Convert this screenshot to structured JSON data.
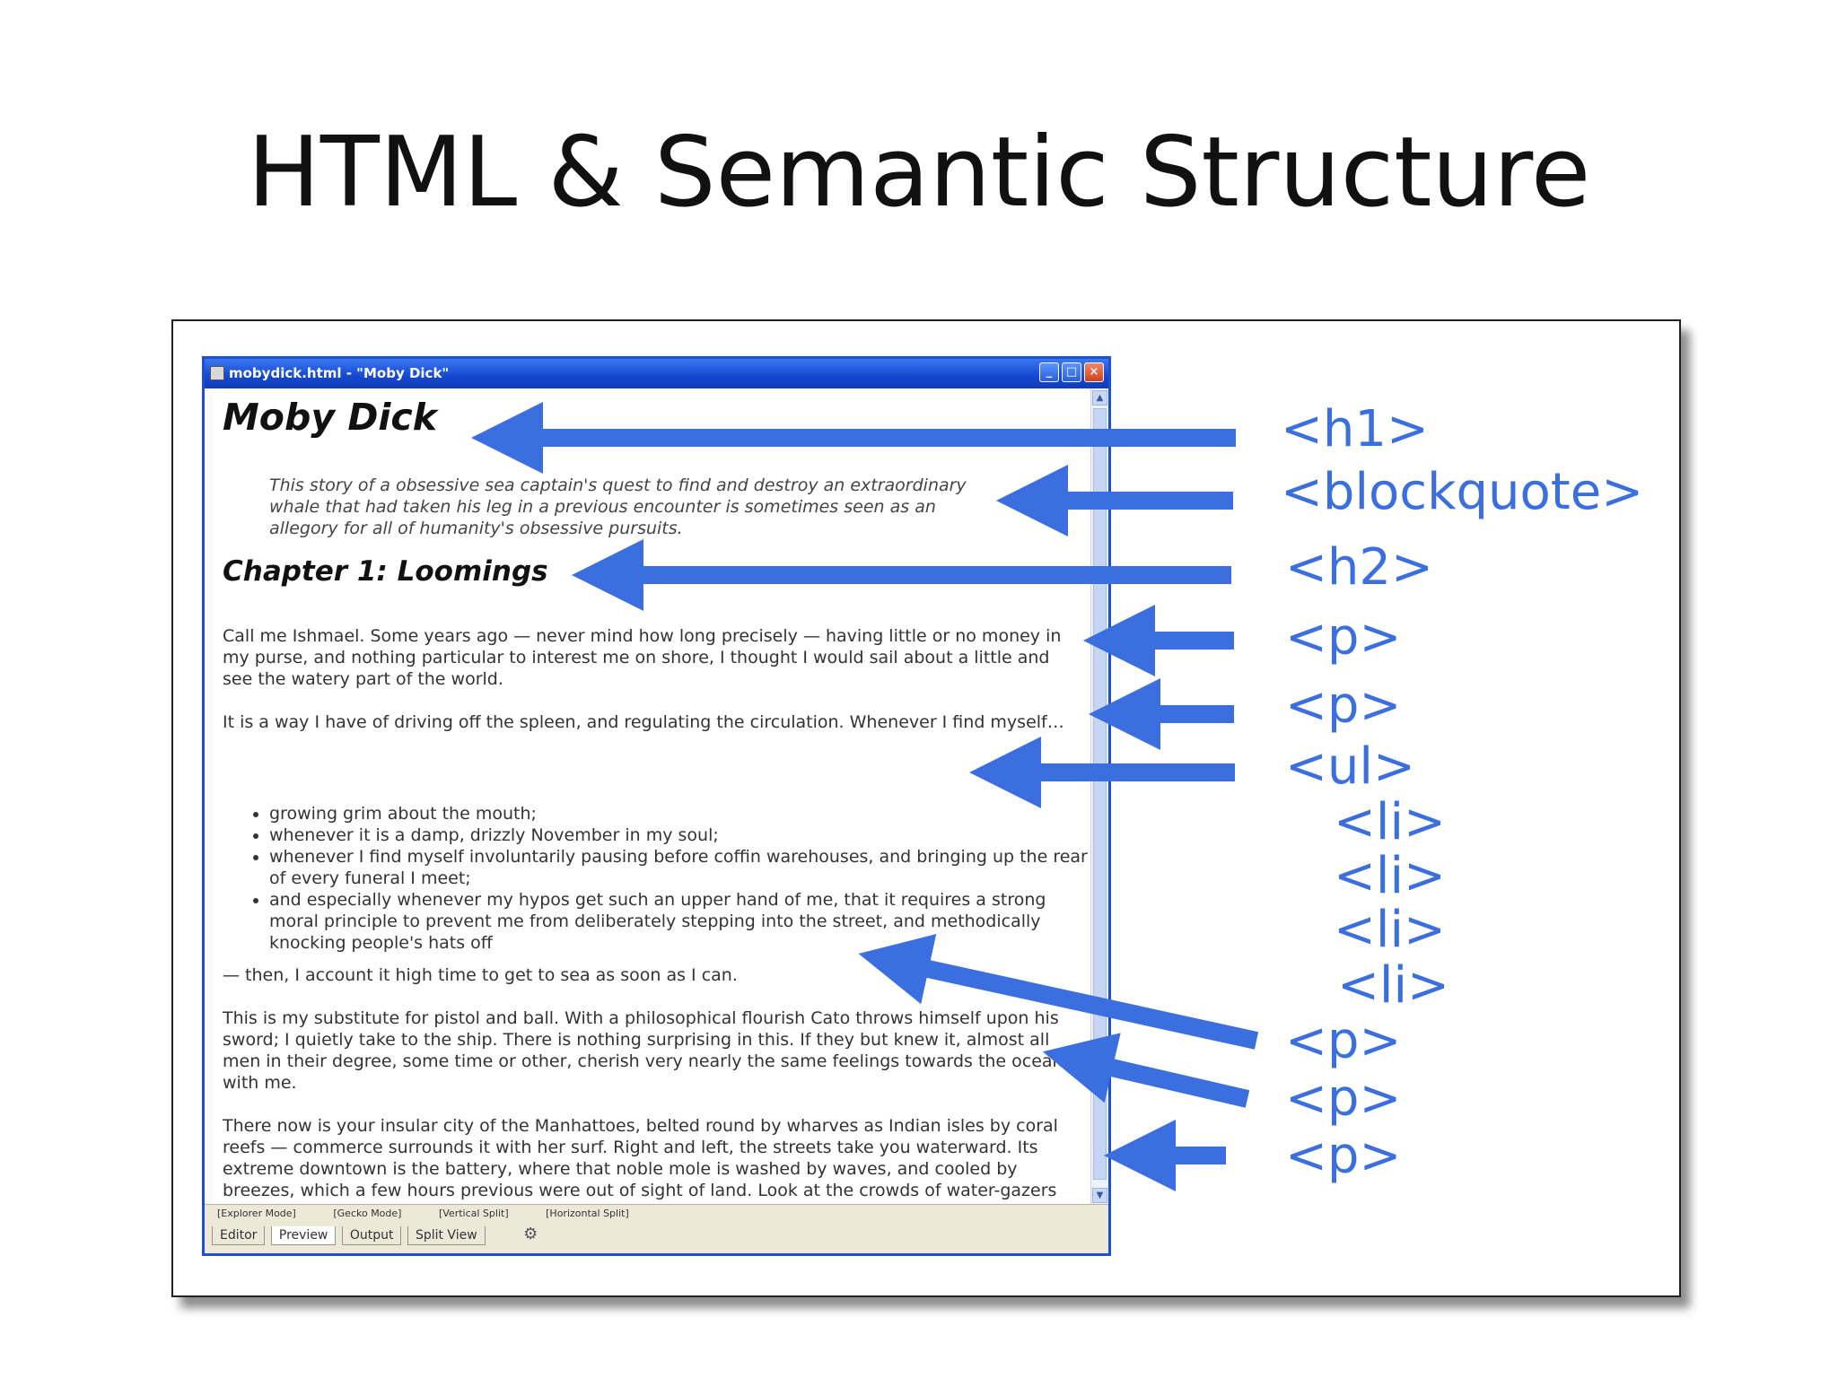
{
  "slide": {
    "title": "HTML & Semantic Structure"
  },
  "window": {
    "title": "mobydick.html - \"Moby Dick\"",
    "controls": {
      "minimize": "_",
      "maximize": "□",
      "close": "×"
    }
  },
  "document": {
    "h1": "Moby Dick",
    "blockquote": "This story of a obsessive sea captain's quest to find and destroy an extraordinary whale that had taken his leg in a previous encounter is sometimes seen as an allegory for all of humanity's obsessive pursuits.",
    "h2": "Chapter 1: Loomings",
    "paragraphs": [
      "Call me Ishmael. Some years ago — never mind how long precisely — having little or no money in my purse, and nothing particular to interest me on shore, I thought I would sail about a little and see the watery part of the world.",
      "It is a way I have of driving off the spleen, and regulating the circulation. Whenever I find myself…",
      "— then, I account it high time to get to sea as soon as I can.",
      "This is my substitute for pistol and ball. With a philosophical flourish Cato throws himself upon his sword; I quietly take to the ship. There is nothing surprising in this. If they but knew it, almost all men in their degree, some time or other, cherish very nearly the same feelings towards the ocean with me.",
      "There now is your insular city of the Manhattoes, belted round by wharves as Indian isles by coral reefs — commerce surrounds it with her surf. Right and left, the streets take you waterward. Its extreme downtown is the battery, where that noble mole is washed by waves, and cooled by breezes, which a few hours previous were out of sight of land. Look at the crowds of water-gazers there."
    ],
    "list": [
      "growing grim about the mouth;",
      "whenever it is a damp, drizzly November in my soul;",
      "whenever I find myself involuntarily pausing before coffin warehouses, and bringing up the rear of every funeral I meet;",
      "and especially whenever my hypos get such an upper hand of me, that it requires a strong moral principle to prevent me from deliberately stepping into the street, and methodically knocking people's hats off"
    ]
  },
  "bottombar": {
    "modes": [
      "[Explorer Mode]",
      "[Gecko Mode]",
      "[Vertical Split]",
      "[Horizontal Split]"
    ],
    "tabs": [
      "Editor",
      "Preview",
      "Output",
      "Split View"
    ]
  },
  "tags": {
    "h1": "<h1>",
    "blockquote": "<blockquote>",
    "h2": "<h2>",
    "p1": "<p>",
    "p2": "<p>",
    "ul": "<ul>",
    "li1": "<li>",
    "li2": "<li>",
    "li3": "<li>",
    "li4": "<li>",
    "p3": "<p>",
    "p4": "<p>",
    "p5": "<p>"
  },
  "colors": {
    "arrow": "#3b6fe0",
    "titlebar": "#1547d0",
    "tag_text": "#3b6fe0"
  }
}
